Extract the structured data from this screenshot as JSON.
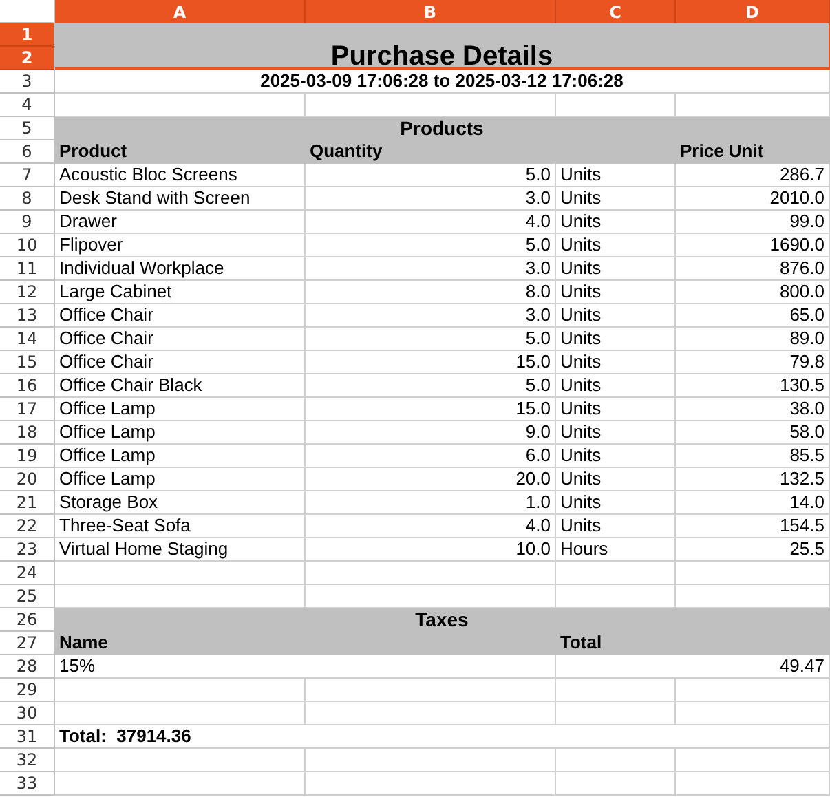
{
  "columns": [
    {
      "label": "A",
      "selected": true
    },
    {
      "label": "B",
      "selected": true
    },
    {
      "label": "C",
      "selected": true
    },
    {
      "label": "D",
      "selected": true
    }
  ],
  "rows": [
    {
      "label": "1",
      "selected": true,
      "kind": "title",
      "cells": [
        {
          "kind": "title",
          "text": "Purchase Details"
        }
      ]
    },
    {
      "label": "2",
      "selected": true,
      "kind": "covered",
      "cells": []
    },
    {
      "label": "3",
      "selected": false,
      "kind": "full",
      "cells": [
        {
          "kind": "subtitle",
          "text": "2025-03-09 17:06:28 to 2025-03-12 17:06:28"
        }
      ]
    },
    {
      "label": "4",
      "selected": false,
      "kind": "blank",
      "cells": []
    },
    {
      "label": "5",
      "selected": false,
      "kind": "full",
      "cells": [
        {
          "kind": "section",
          "text": "Products"
        }
      ]
    },
    {
      "label": "6",
      "selected": false,
      "kind": "three",
      "cells": [
        {
          "kind": "heading",
          "text": "Product"
        },
        {
          "kind": "heading",
          "text": "Quantity"
        },
        {
          "kind": "heading",
          "text": "Price Unit"
        }
      ]
    },
    {
      "label": "7",
      "selected": false,
      "kind": "items",
      "cells": [
        {
          "kind": "text",
          "text": "Acoustic Bloc Screens"
        },
        {
          "kind": "number",
          "text": "5.0"
        },
        {
          "kind": "text",
          "text": "Units"
        },
        {
          "kind": "number",
          "text": "286.7"
        }
      ]
    },
    {
      "label": "8",
      "selected": false,
      "kind": "items",
      "cells": [
        {
          "kind": "text",
          "text": "Desk Stand with Screen"
        },
        {
          "kind": "number",
          "text": "3.0"
        },
        {
          "kind": "text",
          "text": "Units"
        },
        {
          "kind": "number",
          "text": "2010.0"
        }
      ]
    },
    {
      "label": "9",
      "selected": false,
      "kind": "items",
      "cells": [
        {
          "kind": "text",
          "text": "Drawer"
        },
        {
          "kind": "number",
          "text": "4.0"
        },
        {
          "kind": "text",
          "text": "Units"
        },
        {
          "kind": "number",
          "text": "99.0"
        }
      ]
    },
    {
      "label": "10",
      "selected": false,
      "kind": "items",
      "cells": [
        {
          "kind": "text",
          "text": "Flipover"
        },
        {
          "kind": "number",
          "text": "5.0"
        },
        {
          "kind": "text",
          "text": "Units"
        },
        {
          "kind": "number",
          "text": "1690.0"
        }
      ]
    },
    {
      "label": "11",
      "selected": false,
      "kind": "items",
      "cells": [
        {
          "kind": "text",
          "text": "Individual Workplace"
        },
        {
          "kind": "number",
          "text": "3.0"
        },
        {
          "kind": "text",
          "text": "Units"
        },
        {
          "kind": "number",
          "text": "876.0"
        }
      ]
    },
    {
      "label": "12",
      "selected": false,
      "kind": "items",
      "cells": [
        {
          "kind": "text",
          "text": "Large Cabinet"
        },
        {
          "kind": "number",
          "text": "8.0"
        },
        {
          "kind": "text",
          "text": "Units"
        },
        {
          "kind": "number",
          "text": "800.0"
        }
      ]
    },
    {
      "label": "13",
      "selected": false,
      "kind": "items",
      "cells": [
        {
          "kind": "text",
          "text": "Office Chair"
        },
        {
          "kind": "number",
          "text": "3.0"
        },
        {
          "kind": "text",
          "text": "Units"
        },
        {
          "kind": "number",
          "text": "65.0"
        }
      ]
    },
    {
      "label": "14",
      "selected": false,
      "kind": "items",
      "cells": [
        {
          "kind": "text",
          "text": "Office Chair"
        },
        {
          "kind": "number",
          "text": "5.0"
        },
        {
          "kind": "text",
          "text": "Units"
        },
        {
          "kind": "number",
          "text": "89.0"
        }
      ]
    },
    {
      "label": "15",
      "selected": false,
      "kind": "items",
      "cells": [
        {
          "kind": "text",
          "text": "Office Chair"
        },
        {
          "kind": "number",
          "text": "15.0"
        },
        {
          "kind": "text",
          "text": "Units"
        },
        {
          "kind": "number",
          "text": "79.8"
        }
      ]
    },
    {
      "label": "16",
      "selected": false,
      "kind": "items",
      "cells": [
        {
          "kind": "text",
          "text": "Office Chair Black"
        },
        {
          "kind": "number",
          "text": "5.0"
        },
        {
          "kind": "text",
          "text": "Units"
        },
        {
          "kind": "number",
          "text": "130.5"
        }
      ]
    },
    {
      "label": "17",
      "selected": false,
      "kind": "items",
      "cells": [
        {
          "kind": "text",
          "text": "Office Lamp"
        },
        {
          "kind": "number",
          "text": "15.0"
        },
        {
          "kind": "text",
          "text": "Units"
        },
        {
          "kind": "number",
          "text": "38.0"
        }
      ]
    },
    {
      "label": "18",
      "selected": false,
      "kind": "items",
      "cells": [
        {
          "kind": "text",
          "text": "Office Lamp"
        },
        {
          "kind": "number",
          "text": "9.0"
        },
        {
          "kind": "text",
          "text": "Units"
        },
        {
          "kind": "number",
          "text": "58.0"
        }
      ]
    },
    {
      "label": "19",
      "selected": false,
      "kind": "items",
      "cells": [
        {
          "kind": "text",
          "text": "Office Lamp"
        },
        {
          "kind": "number",
          "text": "6.0"
        },
        {
          "kind": "text",
          "text": "Units"
        },
        {
          "kind": "number",
          "text": "85.5"
        }
      ]
    },
    {
      "label": "20",
      "selected": false,
      "kind": "items",
      "cells": [
        {
          "kind": "text",
          "text": "Office Lamp"
        },
        {
          "kind": "number",
          "text": "20.0"
        },
        {
          "kind": "text",
          "text": "Units"
        },
        {
          "kind": "number",
          "text": "132.5"
        }
      ]
    },
    {
      "label": "21",
      "selected": false,
      "kind": "items",
      "cells": [
        {
          "kind": "text",
          "text": "Storage Box"
        },
        {
          "kind": "number",
          "text": "1.0"
        },
        {
          "kind": "text",
          "text": "Units"
        },
        {
          "kind": "number",
          "text": "14.0"
        }
      ]
    },
    {
      "label": "22",
      "selected": false,
      "kind": "items",
      "cells": [
        {
          "kind": "text",
          "text": "Three-Seat Sofa"
        },
        {
          "kind": "number",
          "text": "4.0"
        },
        {
          "kind": "text",
          "text": "Units"
        },
        {
          "kind": "number",
          "text": "154.5"
        }
      ]
    },
    {
      "label": "23",
      "selected": false,
      "kind": "items",
      "cells": [
        {
          "kind": "text",
          "text": "Virtual Home Staging"
        },
        {
          "kind": "number",
          "text": "10.0"
        },
        {
          "kind": "text",
          "text": "Hours"
        },
        {
          "kind": "number",
          "text": "25.5"
        }
      ]
    },
    {
      "label": "24",
      "selected": false,
      "kind": "blank",
      "cells": []
    },
    {
      "label": "25",
      "selected": false,
      "kind": "blank",
      "cells": []
    },
    {
      "label": "26",
      "selected": false,
      "kind": "full",
      "cells": [
        {
          "kind": "section",
          "text": "Taxes"
        }
      ]
    },
    {
      "label": "27",
      "selected": false,
      "kind": "pairs",
      "cells": [
        {
          "kind": "heading",
          "text": "Name"
        },
        {
          "kind": "heading",
          "text": "Total"
        }
      ]
    },
    {
      "label": "28",
      "selected": false,
      "kind": "pairs",
      "cells": [
        {
          "kind": "text",
          "text": "15%"
        },
        {
          "kind": "number",
          "text": "49.47"
        }
      ]
    },
    {
      "label": "29",
      "selected": false,
      "kind": "blank",
      "cells": []
    },
    {
      "label": "30",
      "selected": false,
      "kind": "blank",
      "cells": []
    },
    {
      "label": "31",
      "selected": false,
      "kind": "full",
      "cells": [
        {
          "kind": "total",
          "text": "Total:  37914.36"
        }
      ]
    },
    {
      "label": "32",
      "selected": false,
      "kind": "blank",
      "cells": []
    },
    {
      "label": "33",
      "selected": false,
      "kind": "blank",
      "cells": []
    }
  ]
}
